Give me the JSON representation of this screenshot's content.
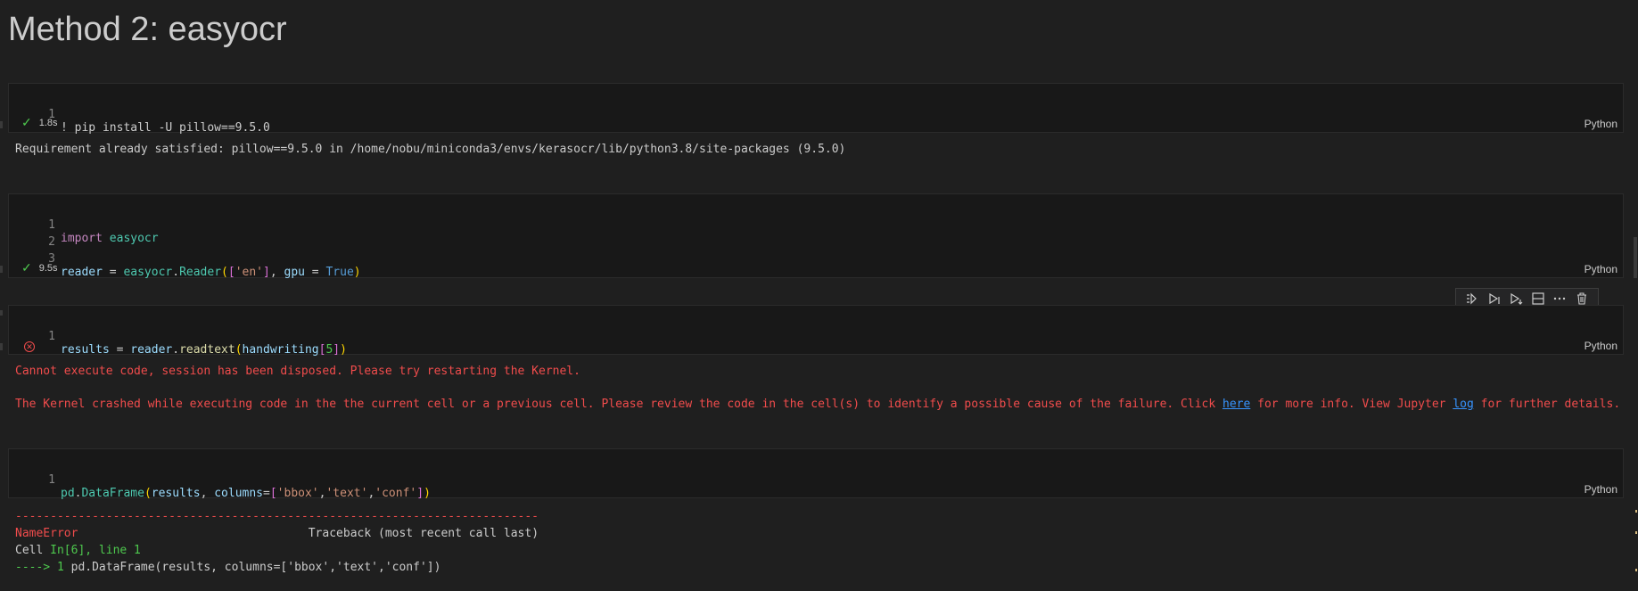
{
  "heading": "Method 2: easyocr",
  "language_label": "Python",
  "cell1": {
    "line_no": "1",
    "code": "! pip install -U pillow==9.5.0",
    "duration": "1.8s",
    "output": "Requirement already satisfied: pillow==9.5.0 in /home/nobu/miniconda3/envs/kerasocr/lib/python3.8/site-packages (9.5.0)"
  },
  "cell2": {
    "line_nos": [
      "1",
      "2",
      "3"
    ],
    "l1_kw": "import",
    "l1_mod": "easyocr",
    "l3": {
      "var": "reader",
      "eq": " = ",
      "mod": "easyocr",
      "dot": ".",
      "fn": "Reader",
      "open": "(",
      "bopen": "[",
      "str": "'en'",
      "bclose": "]",
      "comma": ", ",
      "param": "gpu",
      "eq2": " = ",
      "bool": "True",
      "close": ")"
    },
    "duration": "9.5s"
  },
  "cell3": {
    "line_no": "1",
    "code": {
      "var": "results",
      "eq": " = ",
      "obj": "reader",
      "dot": ".",
      "fn": "readtext",
      "open": "(",
      "arg": "handwriting",
      "bopen": "[",
      "idx": "5",
      "bclose": "]",
      "close": ")"
    },
    "error1": "Cannot execute code, session has been disposed. Please try restarting the Kernel.",
    "error2_pre": "The Kernel crashed while executing code in the the current cell or a previous cell. Please review the code in the cell(s) to identify a possible cause of the failure. Click ",
    "error2_link1": "here",
    "error2_mid": " for more info. View Jupyter ",
    "error2_link2": "log",
    "error2_post": " for further details."
  },
  "cell4": {
    "line_no": "1",
    "code": {
      "obj": "pd",
      "dot": ".",
      "fn": "DataFrame",
      "open": "(",
      "arg": "results",
      "comma": ", ",
      "param": "columns",
      "eq": "=",
      "bopen": "[",
      "s1": "'bbox'",
      "c1": ",",
      "s2": "'text'",
      "c2": ",",
      "s3": "'conf'",
      "bclose": "]",
      "close": ")"
    },
    "tb_dashes": "---------------------------------------------------------------------------",
    "tb_err": "NameError",
    "tb_gap": "                                 ",
    "tb_title": "Traceback (most recent call last)",
    "tb_cell_pre": "Cell ",
    "tb_cell_loc": "In[6], line 1",
    "tb_arrow": "----> 1 ",
    "tb_code": "pd.DataFrame(results, columns=['bbox','text','conf'])"
  },
  "toolbar_icons": [
    "run-by-line-icon",
    "execute-above-icon",
    "execute-below-icon",
    "split-cell-icon",
    "more-actions-icon",
    "delete-cell-icon"
  ],
  "colors": {
    "background": "#1f1f1f",
    "cell_bg": "#181818",
    "error": "#f14c4c",
    "success": "#4ec94e",
    "link": "#3794ff"
  }
}
